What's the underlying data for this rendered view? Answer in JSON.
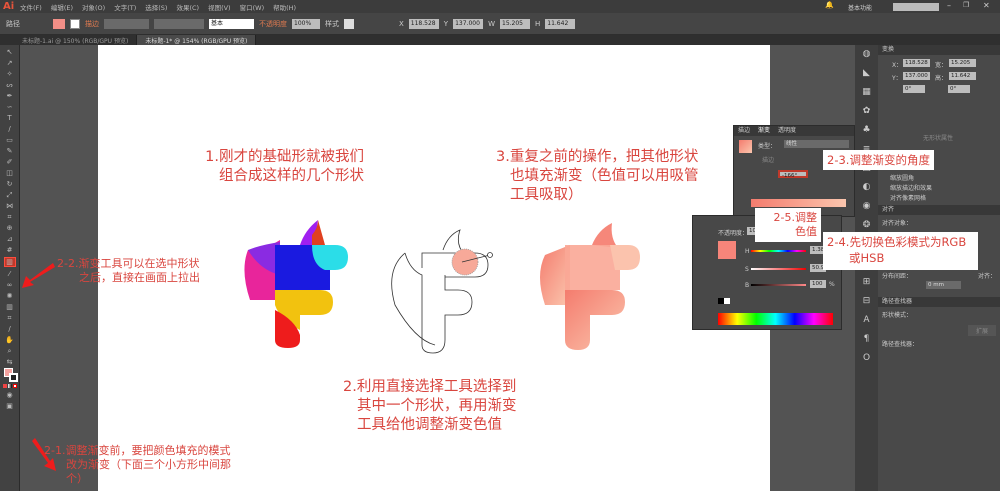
{
  "app": {
    "logo": "Ai"
  },
  "menu": [
    "文件(F)",
    "编辑(E)",
    "对象(O)",
    "文字(T)",
    "选择(S)",
    "效果(C)",
    "视图(V)",
    "窗口(W)",
    "帮助(H)"
  ],
  "window": {
    "workspace": "基本功能",
    "search_placeholder": ""
  },
  "control_bar": {
    "path_label": "路径",
    "stroke_label": "描边",
    "stroke_style": "基本",
    "opacity_label": "不透明度",
    "opacity": "100%",
    "style_label": "样式",
    "x": "118.528",
    "y": "137.000",
    "w": "15.205",
    "h": "11.642"
  },
  "tabs": [
    "未标题-1.ai @ 150% (RGB/GPU 预览)",
    "未标题-1* @ 154% (RGB/GPU 预览)"
  ],
  "annotations": {
    "a1": [
      "1.刚才的基础形就被我们",
      "组合成这样的几个形状"
    ],
    "a3": [
      "3.重复之前的操作，把其他形状",
      "也填充渐变（色值可以用吸管",
      "工具吸取）"
    ],
    "a2": [
      "2.利用直接选择工具选择到",
      "其中一个形状，再用渐变",
      "工具给他调整渐变色值"
    ],
    "a22": [
      "2-2.渐变工具可以在选中形状",
      "之后，直接在画面上拉出"
    ],
    "a21": [
      "2-1.调整渐变前，要把颜色填充的模式",
      "改为渐变（下面三个小方形中间那",
      "个）"
    ],
    "a23": "2-3.调整渐变的角度",
    "a25": [
      "2-5.调整",
      "色值"
    ],
    "a24": [
      "2-4.先切换色彩模式为RGB",
      "或HSB"
    ]
  },
  "gradient_panel": {
    "tabs": [
      "描边",
      "渐变",
      "透明度"
    ],
    "type_label": "类型：",
    "type_value": "线性",
    "stroke_label": "描边",
    "angle": "-166°"
  },
  "color_panel": {
    "opacity_label": "不透明度：",
    "opacity": "100%",
    "h_label": "H",
    "h_value": "1.38",
    "s_label": "S",
    "s_value": "50.98",
    "b_label": "B",
    "b_value": "100",
    "unit": "%"
  },
  "transform_panel": {
    "title": "变换",
    "x_label": "X：",
    "x": "118.528",
    "y_label": "Y：",
    "y": "137.000",
    "w_label": "宽：",
    "w": "15.205",
    "h_label": "高：",
    "h": "11.642",
    "rot": "0°",
    "shear": "0°",
    "no_props": "无形状属性",
    "opts": [
      "缩放圆角",
      "缩放描边和效果",
      "对齐像素网格"
    ]
  },
  "align_panel": {
    "title": "对齐",
    "align_to": "对齐对象：",
    "dist_spacing": "分布间距：",
    "spacing": "0 mm",
    "align_label": "对齐："
  },
  "pathfinder_panel": {
    "title": "路径查找器",
    "shape_modes": "形状模式：",
    "expand": "扩展",
    "pathfinders": "路径查找器："
  },
  "colors": {
    "accent": "#d9463f",
    "gradient_start": "#f7857a",
    "gradient_end": "#fbc0a8"
  }
}
